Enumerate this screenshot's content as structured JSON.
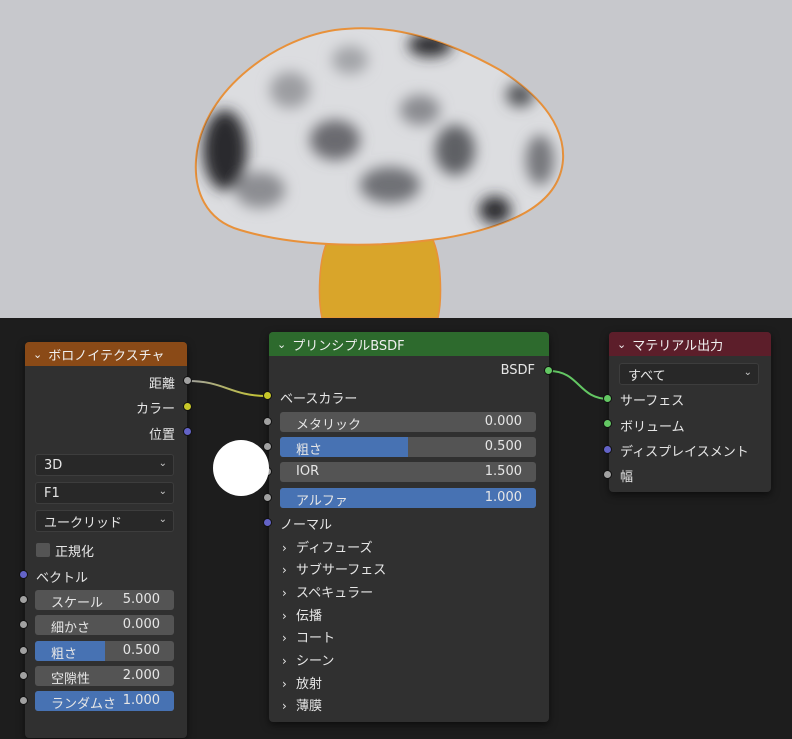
{
  "viewport": {
    "outline_color": "#e8913a",
    "stem_color": "#d9a52a",
    "background": "#c7c8cc"
  },
  "voronoi": {
    "title": "ボロノイテクスチャ",
    "header_color": "#8a4a17",
    "outputs": [
      "距離",
      "カラー",
      "位置"
    ],
    "dropdowns": [
      "3D",
      "F1",
      "ユークリッド"
    ],
    "normalize_label": "正規化",
    "vector_label": "ベクトル",
    "fields": [
      {
        "label": "スケール",
        "value": "5.000"
      },
      {
        "label": "細かさ",
        "value": "0.000"
      },
      {
        "label": "粗さ",
        "value": "0.500",
        "fill": 0.5
      },
      {
        "label": "空隙性",
        "value": "2.000"
      },
      {
        "label": "ランダムさ",
        "value": "1.000",
        "fill": 1.0
      }
    ]
  },
  "bsdf": {
    "title": "プリンシプルBSDF",
    "header_color": "#2d6a2d",
    "output": "BSDF",
    "base_color_label": "ベースカラー",
    "fields": [
      {
        "label": "メタリック",
        "value": "0.000"
      },
      {
        "label": "粗さ",
        "value": "0.500",
        "fill": 0.5
      },
      {
        "label": "IOR",
        "value": "1.500"
      },
      {
        "label": "アルファ",
        "value": "1.000",
        "fill": 1.0
      }
    ],
    "normal_label": "ノーマル",
    "panels": [
      "ディフューズ",
      "サブサーフェス",
      "スペキュラー",
      "伝播",
      "コート",
      "シーン",
      "放射",
      "薄膜"
    ]
  },
  "output": {
    "title": "マテリアル出力",
    "header_color": "#5c1e2a",
    "target": "すべて",
    "inputs": [
      "サーフェス",
      "ボリューム",
      "ディスプレイスメント",
      "幅"
    ]
  }
}
